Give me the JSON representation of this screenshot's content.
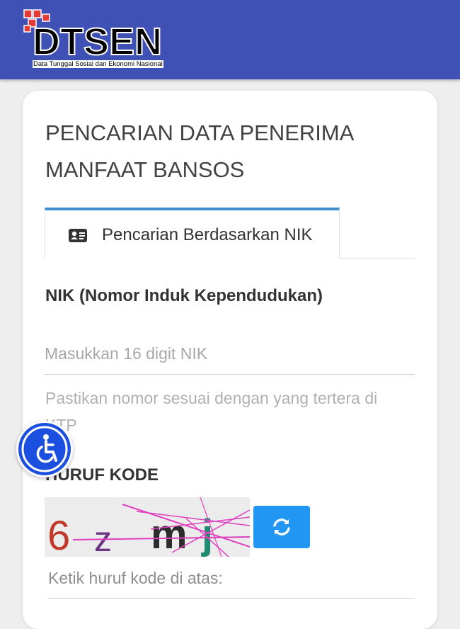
{
  "header": {
    "logo_title": "DTSEN",
    "logo_subtitle": "Data Tunggal Sosial dan Ekonomi Nasional",
    "background": "#3f51b5"
  },
  "page": {
    "title": "PENCARIAN DATA PENERIMA MANFAAT BANSOS"
  },
  "tabs": [
    {
      "label": "Pencarian Berdasarkan NIK",
      "icon": "id-card-icon",
      "active": true
    }
  ],
  "nik": {
    "label": "NIK (Nomor Induk Kependudukan)",
    "placeholder": "Masukkan 16 digit NIK",
    "value": "",
    "hint": "Pastikan nomor sesuai dengan yang tertera di KTP"
  },
  "captcha": {
    "label": "HURUF KODE",
    "image_text": "6 z mj",
    "refresh_icon": "refresh-icon",
    "input_placeholder": "Ketik huruf kode di atas:",
    "input_value": ""
  },
  "accessibility": {
    "icon": "accessibility-icon",
    "color": "#1a4fe0"
  },
  "colors": {
    "accent": "#2196f3",
    "tab_border": "#3d8fd0"
  }
}
